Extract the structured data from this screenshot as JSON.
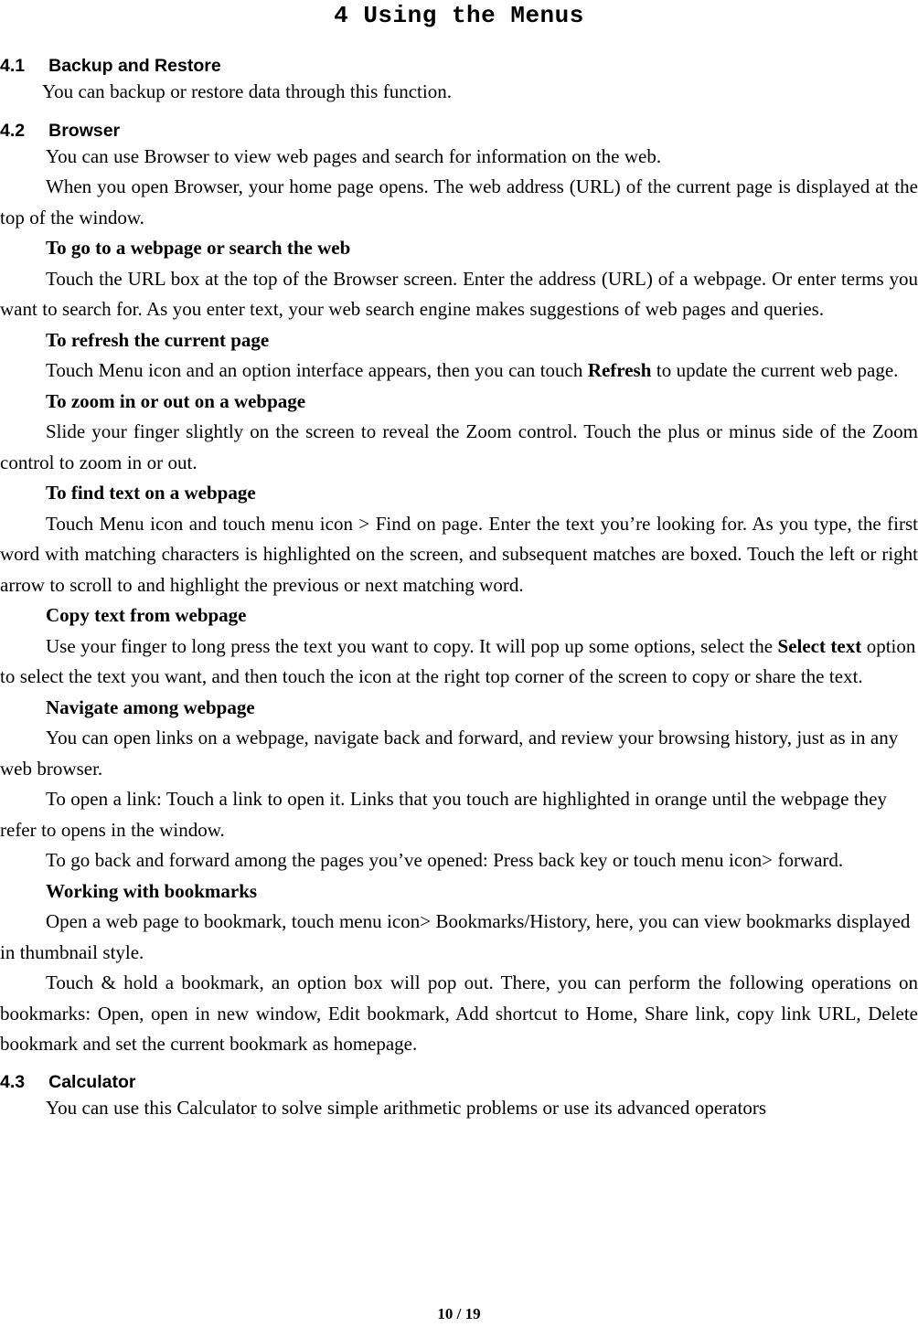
{
  "document": {
    "title": "4 Using the Menus",
    "footer_page": "10 / 19"
  },
  "sections": [
    {
      "number": "4.1",
      "heading": "Backup and Restore",
      "paragraphs": [
        "You can backup or restore data through this function."
      ]
    },
    {
      "number": "4.2",
      "heading": "Browser",
      "paragraphs": [
        "You can use Browser to view web pages and search for information on the web.",
        "When you open Browser, your home page opens. The web address (URL) of the current page is displayed at the top of the window."
      ],
      "subsections": [
        {
          "subhead": "To go to a webpage or search the web",
          "body_pre": "Touch the URL box at the top of the Browser screen. Enter the address (URL) of a webpage. Or enter terms you want to search for. As you enter text, your web search engine makes suggestions of web pages and queries.",
          "body_bold": "",
          "body_post": ""
        },
        {
          "subhead": "To refresh the current page",
          "body_pre": "Touch Menu icon and an option interface appears, then you can touch ",
          "body_bold": "Refresh",
          "body_post": " to update the current web page."
        },
        {
          "subhead": "To zoom in or out on a webpage",
          "body_pre": "Slide your finger slightly on the screen to reveal the Zoom control. Touch the plus or minus side of the Zoom control to zoom in or out.",
          "body_bold": "",
          "body_post": ""
        },
        {
          "subhead": "To find text on a webpage",
          "body_pre": "Touch Menu icon and touch menu icon > Find on page. Enter the text you’re looking for. As you type, the first word with matching characters is highlighted on the screen, and subsequent matches are boxed. Touch the left or right arrow to scroll to and highlight the previous or next matching word.",
          "body_bold": "",
          "body_post": ""
        },
        {
          "subhead": "Copy text from webpage",
          "body_pre": "Use your finger to long press the text you want to copy. It will pop up some options, select the ",
          "body_bold": "Select text",
          "body_post": " option to select the text you want, and then touch the icon at the right top corner of the screen to copy or share the text."
        },
        {
          "subhead": "Navigate among webpage",
          "body_pre": "You can open links on a webpage, navigate back and forward, and review your browsing history, just as in any web browser.",
          "body_bold": "",
          "body_post": ""
        }
      ],
      "extra_paragraphs": [
        "To open a link: Touch a link to open it. Links that you touch are highlighted in orange until the webpage they refer to opens in the window.",
        "To go back and forward among the pages you’ve opened: Press back key or touch menu icon> forward."
      ],
      "bookmarks": {
        "subhead": "Working with bookmarks",
        "paragraph_1": "Open a web page to bookmark, touch menu icon> Bookmarks/History, here, you can view bookmarks displayed in thumbnail style.",
        "paragraph_2": "Touch & hold a bookmark, an option box will pop out. There, you can perform the following operations on bookmarks: Open, open in new window, Edit bookmark, Add shortcut to Home, Share link, copy link URL, Delete bookmark and set the current bookmark as homepage."
      }
    },
    {
      "number": "4.3",
      "heading": "Calculator",
      "paragraphs": [
        "You can use this Calculator to solve simple arithmetic problems or use its advanced operators"
      ]
    }
  ]
}
